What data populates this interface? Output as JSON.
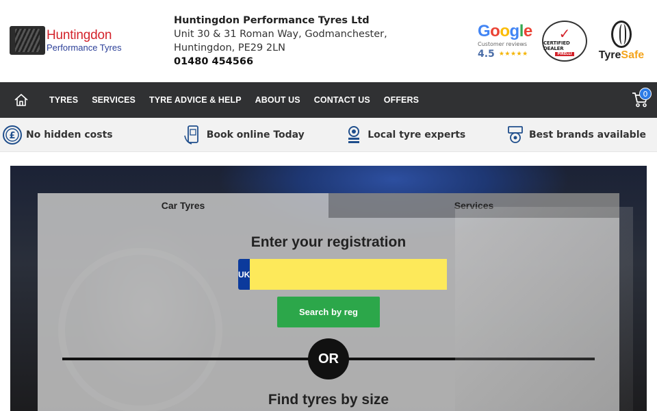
{
  "header": {
    "logo": {
      "name": "Huntingdon",
      "sub": "Performance Tyres"
    },
    "address": {
      "company": "Huntingdon Performance Tyres Ltd",
      "line1": "Unit 30 & 31 Roman Way, Godmanchester,",
      "line2": "Huntingdon, PE29 2LN",
      "phone": "01480 454566"
    },
    "badges": {
      "google_word": "Google",
      "google_sub": "Customer reviews",
      "google_rating": "4.5",
      "google_stars": "★★★★★",
      "cert_label": "CERTIFIED DEALER",
      "cert_brand": "PIRELLI",
      "tyresafe_a": "Tyre",
      "tyresafe_b": "Safe"
    }
  },
  "nav": {
    "items": [
      "TYRES",
      "SERVICES",
      "TYRE ADVICE & HELP",
      "ABOUT US",
      "CONTACT US",
      "OFFERS"
    ],
    "cart_count": "0"
  },
  "usp": [
    {
      "label": "No hidden costs",
      "icon": "pound-coin-icon"
    },
    {
      "label": "Book online Today",
      "icon": "mobile-booking-icon"
    },
    {
      "label": "Local tyre experts",
      "icon": "mechanic-icon"
    },
    {
      "label": "Best brands available",
      "icon": "tyre-brands-icon"
    }
  ],
  "search": {
    "tabs": [
      "Car Tyres",
      "Services"
    ],
    "reg_title": "Enter your registration",
    "reg_prefix": "UK",
    "reg_value": "",
    "reg_button": "Search by reg",
    "or_label": "OR",
    "size_title": "Find tyres by size"
  },
  "colors": {
    "brand_red": "#d3222a",
    "brand_blue": "#2b3f98",
    "nav_bg": "#303133",
    "reg_yellow": "#fde95a",
    "button_green": "#2ca74a"
  }
}
